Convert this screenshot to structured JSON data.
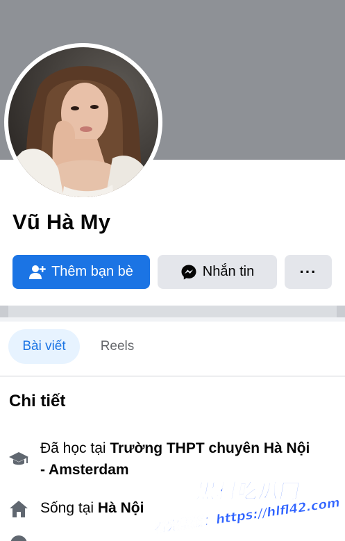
{
  "profile": {
    "name": "Vũ Hà My"
  },
  "actions": {
    "add_friend_label": "Thêm bạn bè",
    "message_label": "Nhắn tin",
    "more_label": "···"
  },
  "tabs": [
    {
      "label": "Bài viết",
      "active": true
    },
    {
      "label": "Reels",
      "active": false
    }
  ],
  "details": {
    "title": "Chi tiết",
    "education": {
      "prefix": "Đã học tại ",
      "value": "Trường THPT chuyên Hà Nội - Amsterdam",
      "icon": "graduation-cap-icon"
    },
    "hometown": {
      "prefix": "Sống tại ",
      "value": "Hà Nội",
      "icon": "home-icon"
    }
  },
  "watermark": {
    "logo": "黑料吃瓜网",
    "url": "看完整版：https://hlfl42.com"
  },
  "colors": {
    "cover": "#8e9196",
    "primary": "#1b74e4",
    "secondary_button": "#e4e6eb",
    "active_tab_bg": "#e7f3ff",
    "watermark": "#2f63ff"
  }
}
